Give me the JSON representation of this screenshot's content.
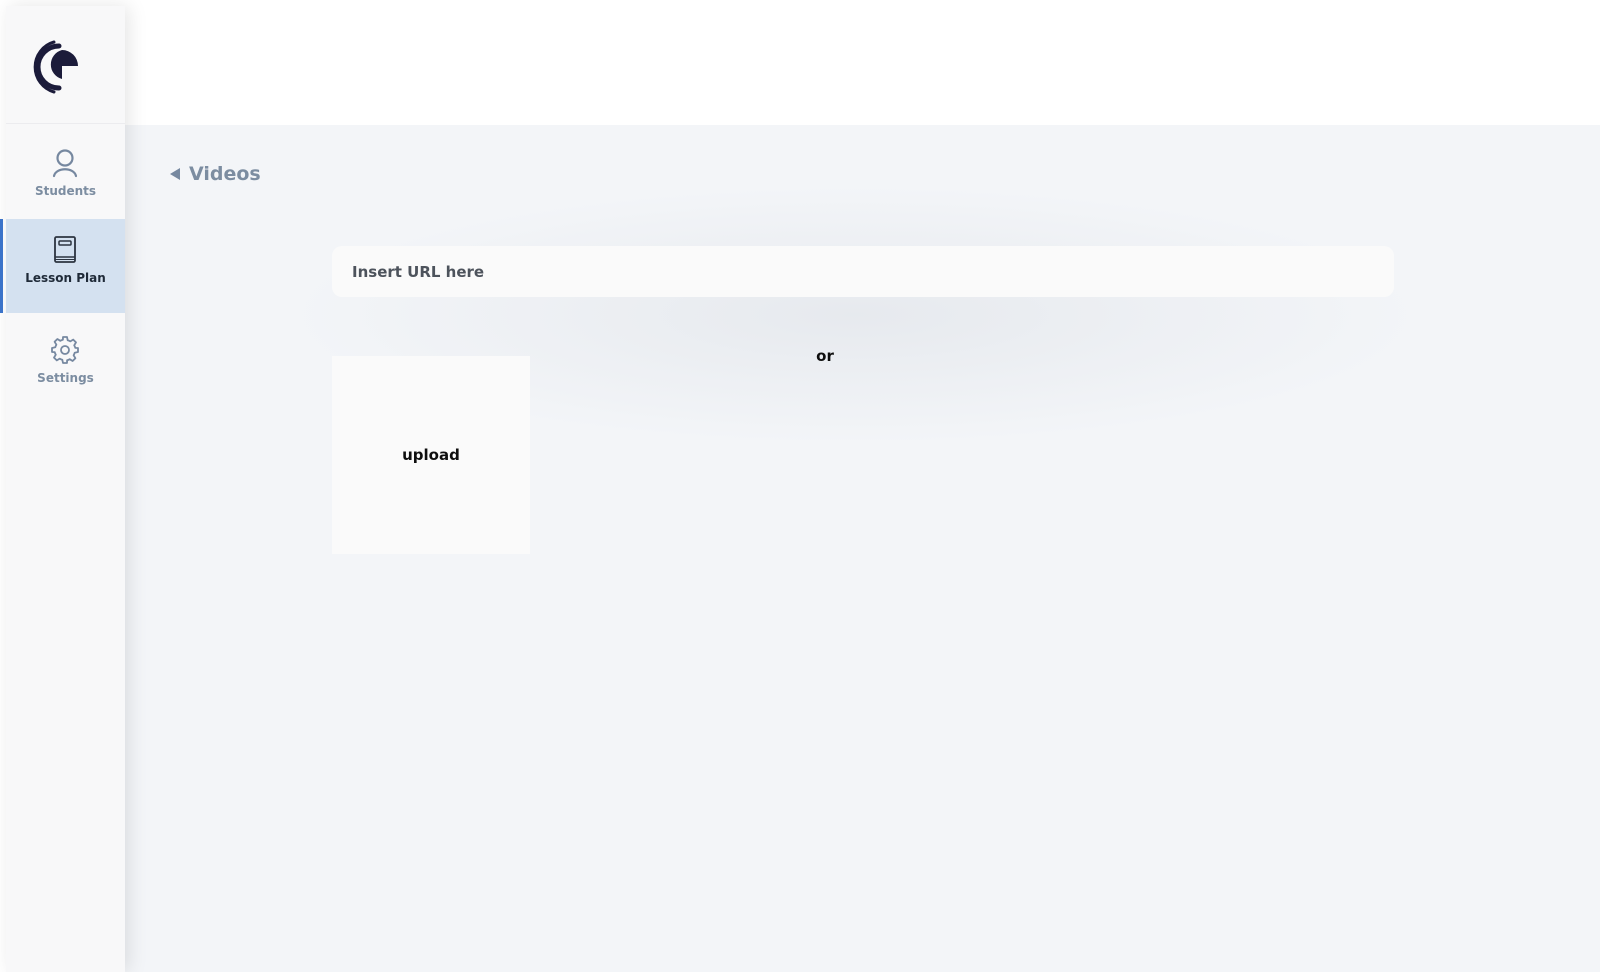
{
  "sidebar": {
    "logo_icon": "crescent-logo-icon",
    "items": [
      {
        "id": "students",
        "label": "Students",
        "icon": "person-icon",
        "active": false
      },
      {
        "id": "lesson-plan",
        "label": "Lesson Plan",
        "icon": "book-icon",
        "active": true
      },
      {
        "id": "settings",
        "label": "Settings",
        "icon": "gear-icon",
        "active": false
      }
    ]
  },
  "main": {
    "back_label": "Videos",
    "url_input": {
      "value": "",
      "placeholder": "Insert URL here"
    },
    "or_label": "or",
    "upload_label": "upload"
  },
  "colors": {
    "accent": "#3b73c9",
    "active_bg": "#d4e1f0",
    "logo": "#1b1b3a",
    "muted_text": "#7c8da1",
    "content_bg": "#f3f5f8"
  }
}
